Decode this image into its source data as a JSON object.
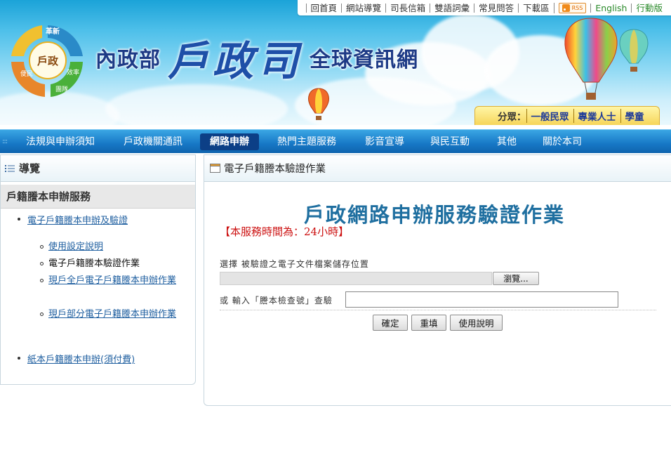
{
  "top_links": [
    "回首頁",
    "網站導覽",
    "司長信箱",
    "雙語詞彙",
    "常見問答",
    "下載區"
  ],
  "rss_label": "RSS",
  "lang_links": [
    "English",
    "行動版"
  ],
  "logo": {
    "top": "革新",
    "center": "戶政",
    "left": "便民",
    "right": "效率",
    "bottom": "團隊"
  },
  "site_title": {
    "part1": "內政部",
    "part2": "戶政司",
    "part3": "全球資訊網"
  },
  "category": {
    "label": "分眾：",
    "items": [
      "一般民眾",
      "專業人士",
      "學童"
    ]
  },
  "nav": {
    "items": [
      "法規與申辦須知",
      "戶政機關通訊",
      "網路申辦",
      "熱門主題服務",
      "影音宣導",
      "與民互動",
      "其他",
      "關於本司"
    ],
    "active": "網路申辦"
  },
  "sidebar": {
    "header": "導覽",
    "section": "戶籍謄本申辦服務",
    "item1": "電子戶籍謄本申辦及驗證",
    "sub_items": [
      "使用設定說明",
      "電子戶籍謄本驗證作業",
      "現戶全戶電子戶籍謄本申辦作業",
      "現戶部分電子戶籍謄本申辦作業"
    ],
    "item2": "紙本戶籍謄本申辦(須付費)"
  },
  "main": {
    "header": "電子戶籍謄本驗證作業",
    "title": "戶政網路申辦服務驗證作業",
    "service_hours": "【本服務時間為：24小時】",
    "select_label": "選擇 被驗證之電子文件檔案儲存位置",
    "browse_button": "瀏覽...",
    "query_label": "或 輸入「謄本檢查號」查驗",
    "buttons": {
      "confirm": "確定",
      "reset": "重填",
      "help": "使用說明"
    }
  }
}
